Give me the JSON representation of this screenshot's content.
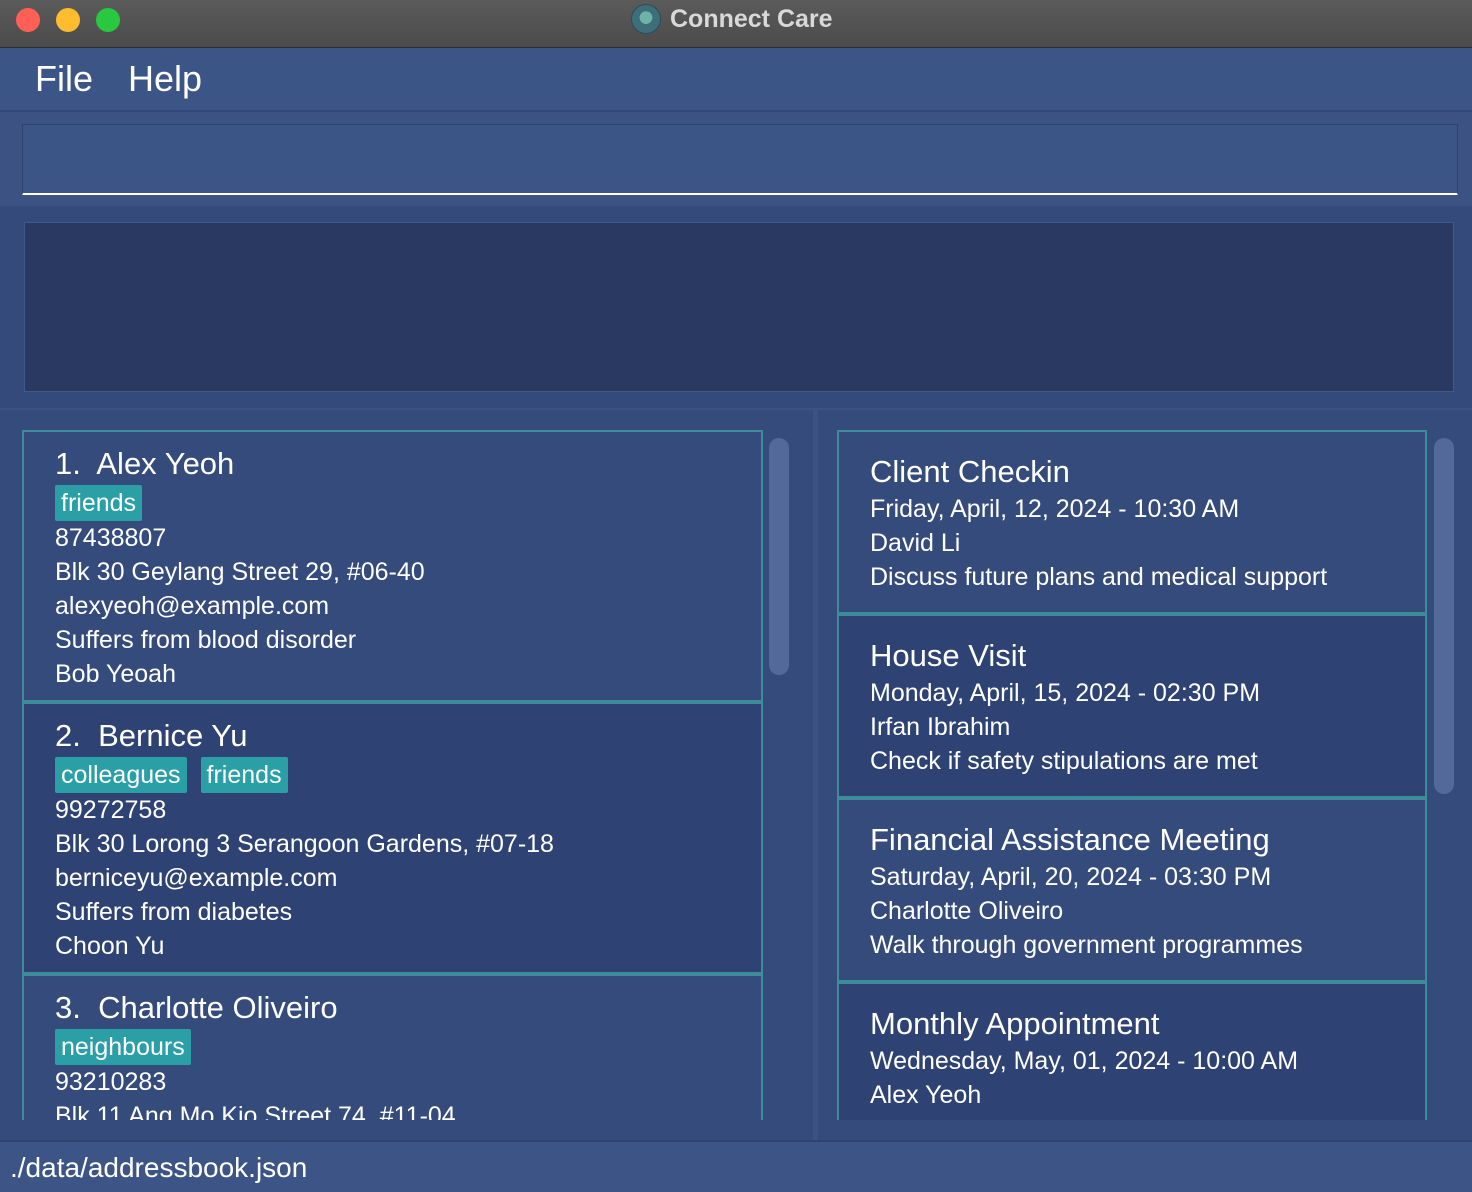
{
  "window": {
    "title": "Connect Care",
    "app_icon": "connect-care-logo-icon"
  },
  "menu": {
    "items": [
      {
        "label": "File"
      },
      {
        "label": "Help"
      }
    ]
  },
  "command_box": {
    "value": ""
  },
  "result_display": {
    "text": ""
  },
  "persons": [
    {
      "index": "1.",
      "name": "Alex Yeoh",
      "tags": [
        "friends"
      ],
      "phone": "87438807",
      "address": "Blk 30 Geylang Street 29, #06-40",
      "email": "alexyeoh@example.com",
      "condition": "Suffers from blood disorder",
      "contact": "Bob Yeoah"
    },
    {
      "index": "2.",
      "name": "Bernice Yu",
      "tags": [
        "colleagues",
        "friends"
      ],
      "phone": "99272758",
      "address": "Blk 30 Lorong 3 Serangoon Gardens, #07-18",
      "email": "berniceyu@example.com",
      "condition": "Suffers from diabetes",
      "contact": "Choon Yu"
    },
    {
      "index": "3.",
      "name": "Charlotte Oliveiro",
      "tags": [
        "neighbours"
      ],
      "phone": "93210283",
      "address": "Blk 11 Ang Mo Kio Street 74, #11-04",
      "email": "",
      "condition": "",
      "contact": ""
    }
  ],
  "appointments": [
    {
      "title": "Client Checkin",
      "datetime": "Friday, April, 12, 2024 - 10:30 AM",
      "person": "David Li",
      "description": "Discuss future plans and medical support"
    },
    {
      "title": "House Visit",
      "datetime": "Monday, April, 15, 2024 - 02:30 PM",
      "person": "Irfan Ibrahim",
      "description": "Check if safety stipulations are met"
    },
    {
      "title": "Financial Assistance Meeting",
      "datetime": "Saturday, April, 20, 2024 - 03:30 PM",
      "person": "Charlotte Oliveiro",
      "description": "Walk through government programmes"
    },
    {
      "title": "Monthly Appointment",
      "datetime": "Wednesday, May, 01, 2024 - 10:00 AM",
      "person": "Alex Yeoh",
      "description": ""
    }
  ],
  "status_bar": {
    "path": "./data/addressbook.json"
  },
  "colors": {
    "background": "#3b5283",
    "card_border": "#3c8c99",
    "tag": "#2a9fa5",
    "result_box": "#293961"
  }
}
